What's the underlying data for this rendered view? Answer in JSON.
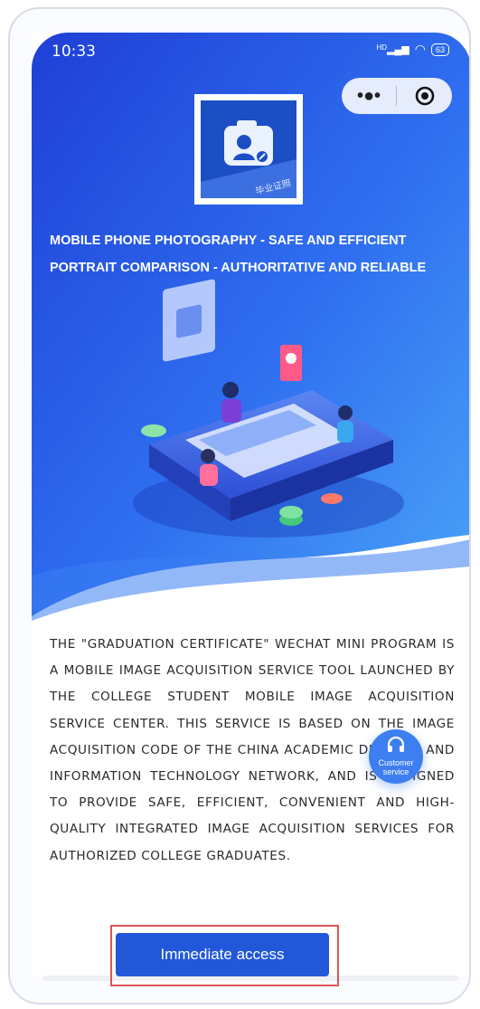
{
  "status_bar": {
    "time": "10:33",
    "network": "HD",
    "battery": "63"
  },
  "capsule": {
    "menu_icon": "more-dots-icon",
    "close_icon": "target-circle-icon"
  },
  "logo": {
    "caption": "毕业证照",
    "icon": "camera-portrait-icon"
  },
  "headline": {
    "line1": "MOBILE PHONE PHOTOGRAPHY - SAFE AND EFFICIENT",
    "line2": "PORTRAIT COMPARISON - AUTHORITATIVE AND RELIABLE"
  },
  "description": "THE \"GRADUATION CERTIFICATE\" WECHAT MINI PROGRAM IS A MOBILE IMAGE ACQUISITION SERVICE TOOL LAUNCHED BY THE COLLEGE STUDENT MOBILE IMAGE ACQUISITION SERVICE CENTER. THIS SERVICE IS BASED ON THE IMAGE ACQUISITION CODE OF THE CHINA ACADEMIC DEGREES AND INFORMATION TECHNOLOGY NETWORK, AND IS DESIGNED TO PROVIDE SAFE, EFFICIENT, CONVENIENT AND HIGH-QUALITY INTEGRATED IMAGE ACQUISITION SERVICES FOR AUTHORIZED COLLEGE GRADUATES.",
  "customer_service": {
    "label_line1": "Customer",
    "label_line2": "service"
  },
  "cta": {
    "label": "Immediate access"
  },
  "colors": {
    "primary": "#2257d9",
    "hero_dark": "#1d43d8",
    "hero_light": "#3d8df5",
    "highlight_border": "#e35357"
  }
}
